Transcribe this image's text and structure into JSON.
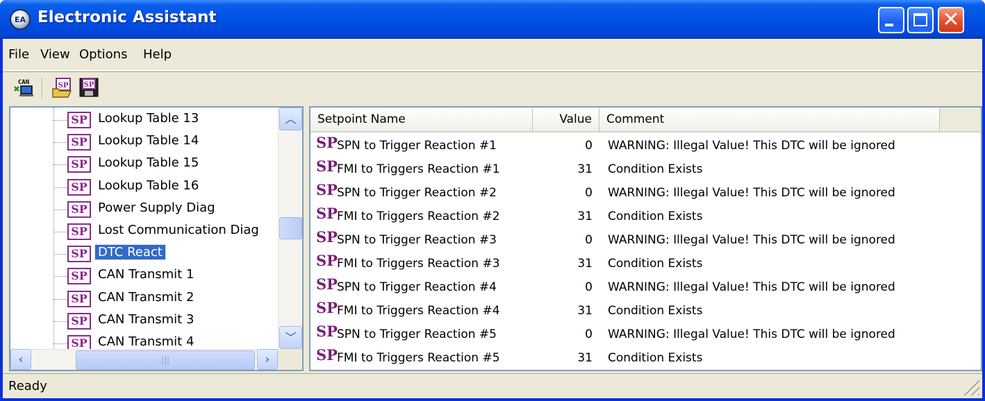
{
  "window": {
    "title": "Electronic Assistant",
    "icon": "ea-app-icon"
  },
  "menu": [
    {
      "label": "File"
    },
    {
      "label": "View"
    },
    {
      "label": "Options"
    },
    {
      "label": "Help"
    }
  ],
  "toolbar": {
    "buttons": [
      {
        "icon": "can-connect-icon",
        "label": "CAN"
      },
      {
        "icon": "open-setpoint-file-icon",
        "label": "SP"
      },
      {
        "icon": "save-setpoint-file-icon",
        "label": "SP"
      }
    ]
  },
  "tree": {
    "badge": "SP",
    "items": [
      {
        "label": "Lookup Table 13"
      },
      {
        "label": "Lookup Table 14"
      },
      {
        "label": "Lookup Table 15"
      },
      {
        "label": "Lookup Table 16"
      },
      {
        "label": "Power Supply Diag"
      },
      {
        "label": "Lost Communication Diag"
      },
      {
        "label": "DTC React",
        "selected": true
      },
      {
        "label": "CAN Transmit 1"
      },
      {
        "label": "CAN Transmit 2"
      },
      {
        "label": "CAN Transmit 3"
      },
      {
        "label": "CAN Transmit 4"
      }
    ]
  },
  "list": {
    "headers": {
      "name": "Setpoint Name",
      "value": "Value",
      "comment": "Comment"
    },
    "row_badge": "SP",
    "rows": [
      {
        "name": "SPN to Trigger Reaction  #1",
        "value": "0",
        "comment": "WARNING: Illegal Value! This DTC will be ignored"
      },
      {
        "name": "FMI to Triggers Reaction #1",
        "value": "31",
        "comment": "Condition Exists"
      },
      {
        "name": "SPN to Trigger Reaction  #2",
        "value": "0",
        "comment": "WARNING: Illegal Value! This DTC will be ignored"
      },
      {
        "name": "FMI to Triggers Reaction #2",
        "value": "31",
        "comment": "Condition Exists"
      },
      {
        "name": "SPN to Trigger Reaction  #3",
        "value": "0",
        "comment": "WARNING: Illegal Value! This DTC will be ignored"
      },
      {
        "name": "FMI to Triggers Reaction #3",
        "value": "31",
        "comment": "Condition Exists"
      },
      {
        "name": "SPN to Trigger Reaction  #4",
        "value": "0",
        "comment": "WARNING: Illegal Value! This DTC will be ignored"
      },
      {
        "name": "FMI to Triggers Reaction #4",
        "value": "31",
        "comment": "Condition Exists"
      },
      {
        "name": "SPN to Trigger Reaction  #5",
        "value": "0",
        "comment": "WARNING: Illegal Value! This DTC will be ignored"
      },
      {
        "name": "FMI to Triggers Reaction #5",
        "value": "31",
        "comment": "Condition Exists"
      }
    ]
  },
  "status": {
    "text": "Ready"
  },
  "colors": {
    "title_blue": "#0050E6",
    "selection": "#316AC5",
    "sp_purple": "#7a1f7a",
    "face": "#ECE9D8"
  }
}
